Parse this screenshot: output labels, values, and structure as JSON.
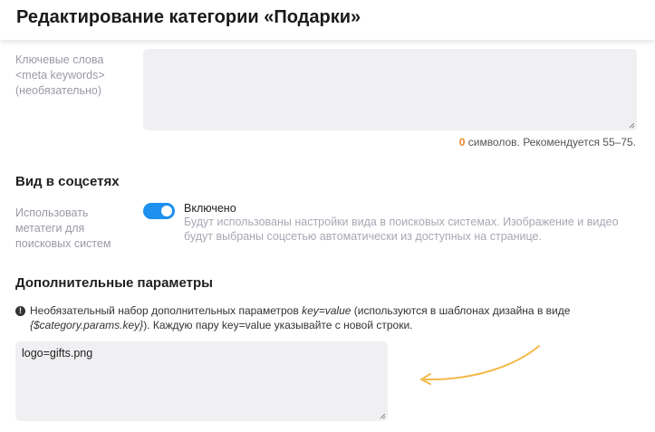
{
  "header": {
    "title": "Редактирование категории «Подарки»"
  },
  "meta_keywords": {
    "label_line1": "Ключевые слова",
    "label_line2": "<meta keywords>",
    "label_line3": "(необязательно)",
    "value": "",
    "counter_value": "0",
    "counter_text": " символов. Рекомендуется 55–75."
  },
  "social": {
    "title": "Вид в соцсетях",
    "label_line1": "Использовать",
    "label_line2": "метатеги для",
    "label_line3": "поисковых систем",
    "toggle_state": "Включено",
    "toggle_on": true,
    "hint": "Будут использованы настройки вида в поисковых системах. Изображение и видео будут выбраны соцсетью автоматически из доступных на странице."
  },
  "params": {
    "title": "Дополнительные параметры",
    "info_part1": "Необязательный набор дополнительных параметров ",
    "info_key": "key=value",
    "info_part2": " (используются в шаблонах дизайна в виде ",
    "info_var": "{$category.params.key}",
    "info_part3": "). Каждую пару key=value указывайте с новой строки.",
    "value": "logo=gifts.png"
  },
  "colors": {
    "accent": "#1e90f0",
    "counter": "#e8862f",
    "arrow": "#f5b94a",
    "field_bg": "#f0f0f3"
  },
  "icons": {
    "info": "info-circle-icon",
    "resize": "resize-handle-icon",
    "arrow": "curved-arrow-icon"
  }
}
